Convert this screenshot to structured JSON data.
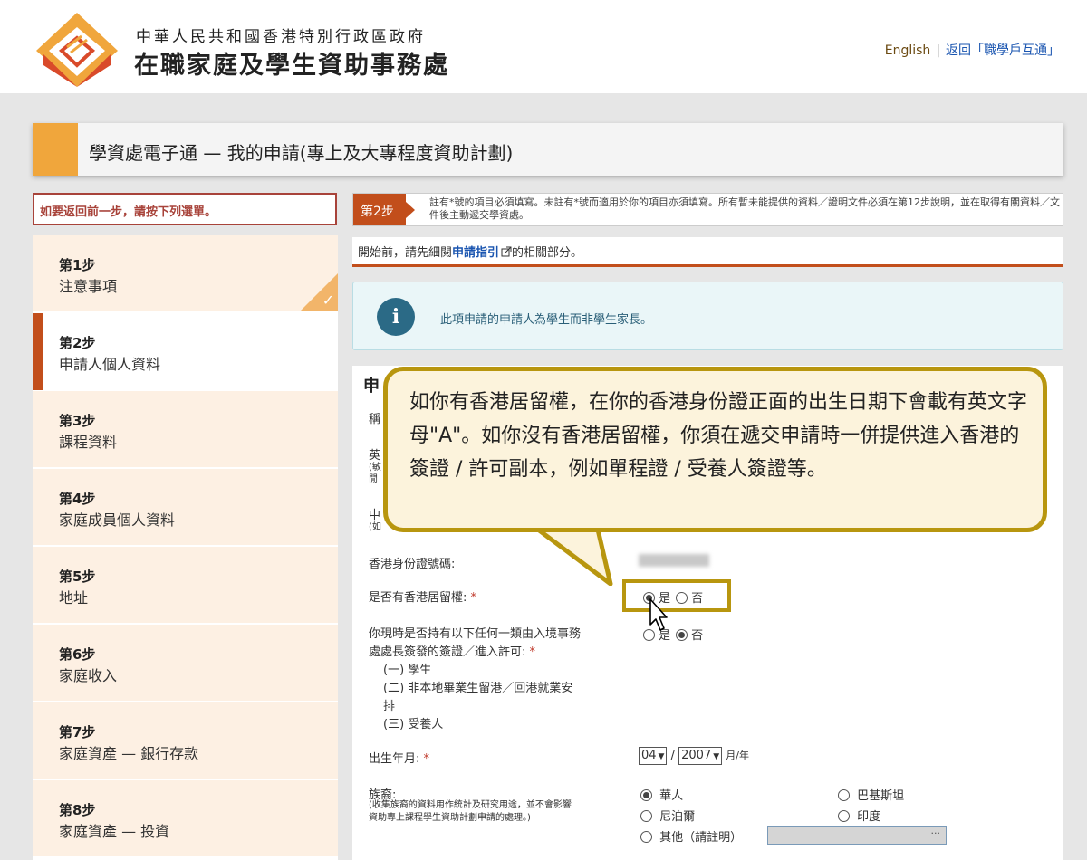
{
  "header": {
    "gov_name": "中華人民共和國香港特別行政區政府",
    "dept_name": "在職家庭及學生資助事務處",
    "lang_link": "English",
    "separator": "|",
    "back_link": "返回「職學戶互通」",
    "logo_colors": [
      "#f0a63c",
      "#d94a2a"
    ]
  },
  "title_bar": {
    "text": "學資處電子通 — 我的申請(專上及大專程度資助計劃)"
  },
  "sidebar": {
    "back_hint": "如要返回前一步，請按下列選單。",
    "steps": [
      {
        "num": "第1步",
        "name": "注意事項",
        "done": true
      },
      {
        "num": "第2步",
        "name": "申請人個人資料",
        "active": true
      },
      {
        "num": "第3步",
        "name": "課程資料"
      },
      {
        "num": "第4步",
        "name": "家庭成員個人資料"
      },
      {
        "num": "第5步",
        "name": "地址"
      },
      {
        "num": "第6步",
        "name": "家庭收入"
      },
      {
        "num": "第7步",
        "name": "家庭資產 — 銀行存款"
      },
      {
        "num": "第8步",
        "name": "家庭資產 — 投資"
      }
    ],
    "check_mark": "✓"
  },
  "main": {
    "step_tag": "第2步",
    "step_note": "註有*號的項目必須填寫。未註有*號而適用於你的項目亦須填寫。所有暫未能提供的資料／證明文件必須在第12步說明，並在取得有關資料／文件後主動遞交學資處。",
    "read_first_prefix": "開始前，請先細閱",
    "read_first_link": "申請指引",
    "read_first_suffix": "的相關部分。",
    "info_icon": "i",
    "info_message": "此項申請的申請人為學生而非學生家長。",
    "section_title": "申",
    "partial_labels": {
      "row1": "稱",
      "row2a": "英",
      "row2b": "(敏",
      "row2c": "閒",
      "row3a": "中",
      "row3b": "(如"
    },
    "hkid_label": "香港身份證號碼:",
    "right_of_abode_label": "是否有香港居留權:",
    "req_star": "*",
    "yes": "是",
    "no": "否",
    "visa_label_1": "你現時是否持有以下任何一類由入境事務",
    "visa_label_2": "處處長簽發的簽證／進入許可:",
    "visa_items": [
      "(一) 學生",
      "(二) 非本地畢業生留港／回港就業安",
      "排",
      "(三) 受養人"
    ],
    "dob_label": "出生年月:",
    "dob_month": "04",
    "dob_sep": "/",
    "dob_year": "2007",
    "dob_unit": "月/年",
    "ethnicity_label": "族裔:",
    "ethnicity_note_1": "(收集族裔的資料用作統計及研究用途，並不會影響",
    "ethnicity_note_2": "資助專上課程學生資助計劃申請的處理。)",
    "ethnicity_options": {
      "chinese": "華人",
      "pakistani": "巴基斯坦",
      "nepalese": "尼泊爾",
      "indian": "印度",
      "other": "其他（請註明）"
    },
    "other_dots": "···"
  },
  "callout": {
    "text": "如你有香港居留權，在你的香港身份證正面的出生日期下會載有英文字母\"A\"。如你沒有香港居留權，你須在遞交申請時一併提供進入香港的簽證 / 許可副本，例如單程證 / 受養人簽證等。",
    "border_color": "#b8960f",
    "fill_color": "#fcf3dc"
  }
}
